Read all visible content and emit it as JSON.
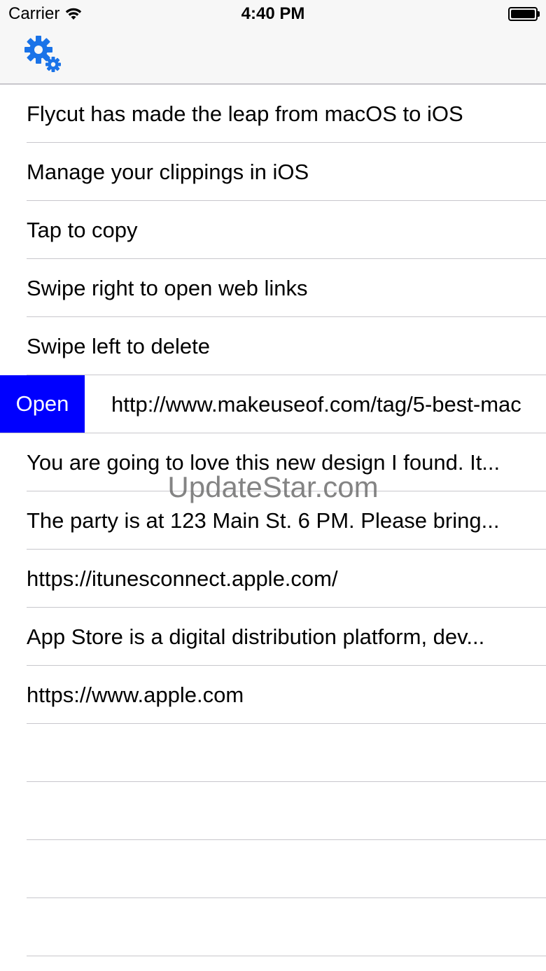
{
  "status_bar": {
    "carrier": "Carrier",
    "time": "4:40 PM",
    "wifi_icon": "wifi-icon",
    "battery_icon": "battery-icon"
  },
  "nav_bar": {
    "settings_icon": "gears-icon",
    "accent_color": "#1a73e8"
  },
  "clippings": [
    {
      "label": "Flycut has made the leap from macOS to iOS"
    },
    {
      "label": "Manage your clippings in iOS"
    },
    {
      "label": "Tap to copy"
    },
    {
      "label": "Swipe right to open web links"
    },
    {
      "label": "Swipe left to delete"
    },
    {
      "label": "http://www.makeuseof.com/tag/5-best-mac",
      "action_label": "Open",
      "action_color": "#0000ff"
    },
    {
      "label": "You are going to love this new design I found. It..."
    },
    {
      "label": "The party is at 123 Main St. 6 PM. Please bring..."
    },
    {
      "label": "https://itunesconnect.apple.com/"
    },
    {
      "label": "App Store is a digital distribution platform, dev..."
    },
    {
      "label": "https://www.apple.com"
    },
    {
      "label": ""
    },
    {
      "label": ""
    },
    {
      "label": ""
    },
    {
      "label": ""
    }
  ],
  "watermark": "UpdateStar.com"
}
